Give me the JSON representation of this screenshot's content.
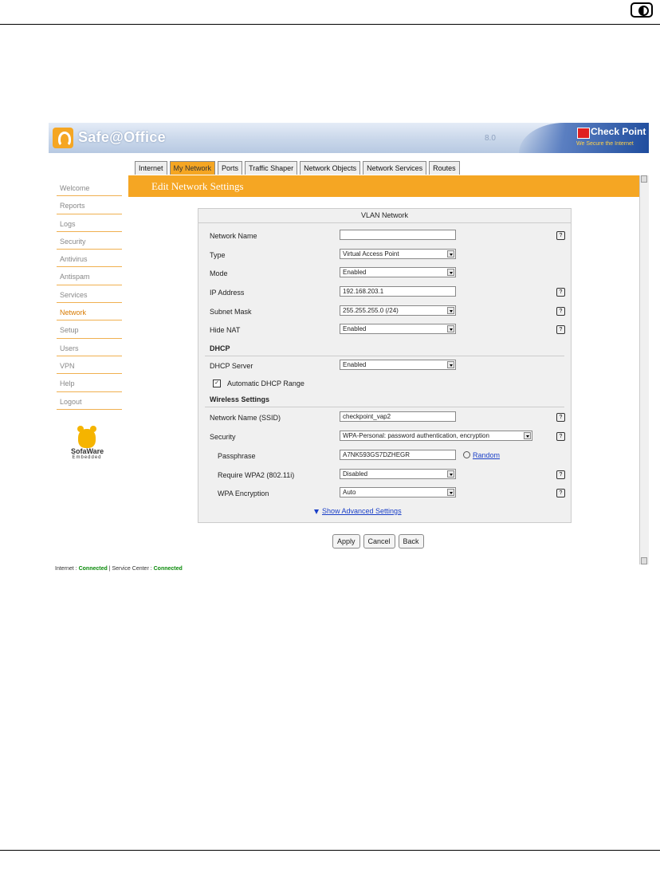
{
  "header": {
    "brand": "Safe@Office",
    "version": "8.0",
    "vendor": "Check Point",
    "tagline": "We Secure the Internet"
  },
  "tabs": [
    "Internet",
    "My Network",
    "Ports",
    "Traffic Shaper",
    "Network Objects",
    "Network Services",
    "Routes"
  ],
  "active_tab": "My Network",
  "sidebar": [
    "Welcome",
    "Reports",
    "Logs",
    "Security",
    "Antivirus",
    "Antispam",
    "Services",
    "Network",
    "Setup",
    "Users",
    "VPN",
    "Help",
    "Logout"
  ],
  "active_sidebar": "Network",
  "sofa": {
    "name": "SofaWare",
    "sub": "Embedded"
  },
  "page_title": "Edit Network Settings",
  "panel": {
    "title": "VLAN Network",
    "network_name": {
      "label": "Network Name",
      "value": ""
    },
    "type": {
      "label": "Type",
      "value": "Virtual Access Point"
    },
    "mode": {
      "label": "Mode",
      "value": "Enabled"
    },
    "ip": {
      "label": "IP Address",
      "value": "192.168.203.1"
    },
    "subnet": {
      "label": "Subnet Mask",
      "value": "255.255.255.0 (/24)"
    },
    "hide_nat": {
      "label": "Hide NAT",
      "value": "Enabled"
    },
    "dhcp_section": "DHCP",
    "dhcp_server": {
      "label": "DHCP Server",
      "value": "Enabled"
    },
    "auto_dhcp": {
      "label": "Automatic DHCP Range",
      "checked": true
    },
    "wireless_section": "Wireless Settings",
    "ssid": {
      "label": "Network Name (SSID)",
      "value": "checkpoint_vap2"
    },
    "security": {
      "label": "Security",
      "value": "WPA-Personal: password authentication, encryption"
    },
    "passphrase": {
      "label": "Passphrase",
      "value": "A7NK593GS7DZHEGR"
    },
    "random_link": "Random",
    "wpa2": {
      "label": "Require WPA2 (802.11i)",
      "value": "Disabled"
    },
    "wpa_enc": {
      "label": "WPA Encryption",
      "value": "Auto"
    },
    "advanced_link": "Show Advanced Settings"
  },
  "buttons": {
    "apply": "Apply",
    "cancel": "Cancel",
    "back": "Back"
  },
  "status": {
    "internet_label": "Internet :",
    "internet_value": "Connected",
    "sep": "| Service Center :",
    "service_value": "Connected"
  }
}
